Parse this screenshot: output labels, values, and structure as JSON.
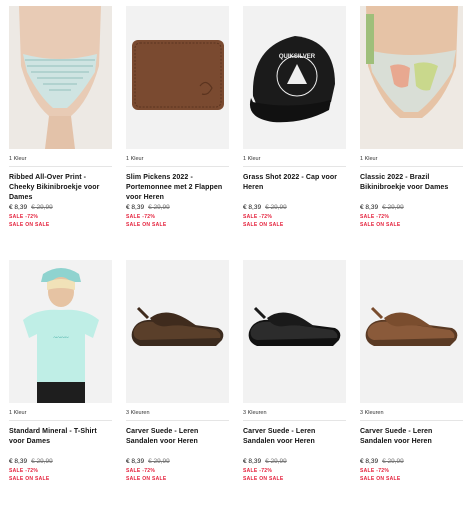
{
  "products": [
    {
      "colors": "1 Kleur",
      "name": "Ribbed All-Over Print - Cheeky Bikinibroekje voor Dames",
      "price": "€ 8,39",
      "old_price": "€ 29,99",
      "discount": "SALE -72%",
      "badge": "SALE ON SALE",
      "icon": "bikini-bottom-image"
    },
    {
      "colors": "1 Kleur",
      "name": "Slim Pickens 2022 - Portemonnee met 2 Flappen voor Heren",
      "price": "€ 8,39",
      "old_price": "€ 29,99",
      "discount": "SALE -72%",
      "badge": "SALE ON SALE",
      "icon": "wallet-image"
    },
    {
      "colors": "1 Kleur",
      "name": "Grass Shot 2022 - Cap voor Heren",
      "price": "€ 8,39",
      "old_price": "€ 29,99",
      "discount": "SALE -72%",
      "badge": "SALE ON SALE",
      "icon": "cap-image",
      "cap_text": "QUIKSILVER"
    },
    {
      "colors": "1 Kleur",
      "name": "Classic 2022 - Brazil Bikinibroekje voor Dames",
      "price": "€ 8,39",
      "old_price": "€ 29,99",
      "discount": "SALE -72%",
      "badge": "SALE ON SALE",
      "icon": "bikini-bottom-image"
    },
    {
      "colors": "1 Kleur",
      "name": "Standard Mineral - T-Shirt voor Dames",
      "price": "€ 8,39",
      "old_price": "€ 29,99",
      "discount": "SALE -72%",
      "badge": "SALE ON SALE",
      "icon": "tshirt-model-image"
    },
    {
      "colors": "3 Kleuren",
      "name": "Carver Suede - Leren Sandalen voor Heren",
      "price": "€ 8,39",
      "old_price": "€ 29,99",
      "discount": "SALE -72%",
      "badge": "SALE ON SALE",
      "icon": "sandal-image",
      "sandal_color": "#5a3f2a"
    },
    {
      "colors": "3 Kleuren",
      "name": "Carver Suede - Leren Sandalen voor Heren",
      "price": "€ 8,39",
      "old_price": "€ 29,99",
      "discount": "SALE -72%",
      "badge": "SALE ON SALE",
      "icon": "sandal-image",
      "sandal_color": "#2c2c2c"
    },
    {
      "colors": "3 Kleuren",
      "name": "Carver Suede - Leren Sandalen voor Heren",
      "price": "€ 8,39",
      "old_price": "€ 29,99",
      "discount": "SALE -72%",
      "badge": "SALE ON SALE",
      "icon": "sandal-image",
      "sandal_color": "#8a5a3a"
    }
  ],
  "colors": {
    "sale_red": "#e4203b",
    "image_bg": "#f1f1f1"
  }
}
